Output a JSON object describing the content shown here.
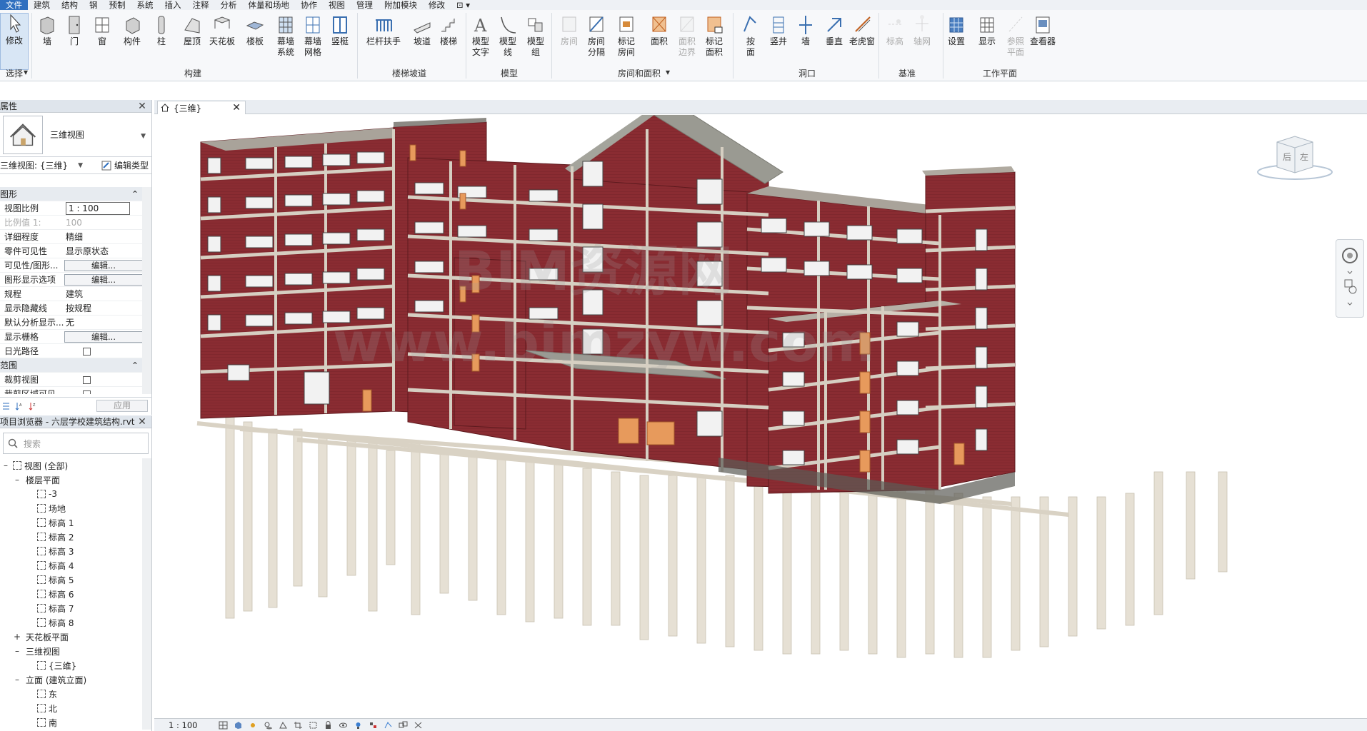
{
  "menu": {
    "items": [
      "文件",
      "建筑",
      "结构",
      "钢",
      "预制",
      "系统",
      "插入",
      "注释",
      "分析",
      "体量和场地",
      "协作",
      "视图",
      "管理",
      "附加模块",
      "修改"
    ],
    "active_index": 0
  },
  "ribbon": {
    "buttons": [
      {
        "label": "修改",
        "icon": "modify-arrow-icon"
      },
      {
        "label": "墙",
        "icon": "wall-icon"
      },
      {
        "label": "门",
        "icon": "door-icon"
      },
      {
        "label": "窗",
        "icon": "window-icon"
      },
      {
        "label": "构件",
        "icon": "component-icon"
      },
      {
        "label": "柱",
        "icon": "column-icon"
      },
      {
        "label": "屋顶",
        "icon": "roof-icon"
      },
      {
        "label": "天花板",
        "icon": "ceiling-icon"
      },
      {
        "label": "楼板",
        "icon": "floor-icon"
      },
      {
        "label": "幕墙\n系统",
        "icon": "curtain-system-icon"
      },
      {
        "label": "幕墙\n网格",
        "icon": "curtain-grid-icon"
      },
      {
        "label": "竖梃",
        "icon": "mullion-icon"
      },
      {
        "label": "栏杆扶手",
        "icon": "railing-icon"
      },
      {
        "label": "坡道",
        "icon": "ramp-icon"
      },
      {
        "label": "楼梯",
        "icon": "stair-icon"
      },
      {
        "label": "模型\n文字",
        "icon": "model-text-icon"
      },
      {
        "label": "模型\n线",
        "icon": "model-line-icon"
      },
      {
        "label": "模型\n组",
        "icon": "model-group-icon"
      },
      {
        "label": "房间",
        "icon": "room-icon",
        "disabled": true
      },
      {
        "label": "房间\n分隔",
        "icon": "room-separator-icon"
      },
      {
        "label": "标记\n房间",
        "icon": "tag-room-icon"
      },
      {
        "label": "面积",
        "icon": "area-icon"
      },
      {
        "label": "面积\n边界",
        "icon": "area-boundary-icon",
        "disabled": true
      },
      {
        "label": "标记\n面积",
        "icon": "tag-area-icon"
      },
      {
        "label": "按\n面",
        "icon": "by-face-icon"
      },
      {
        "label": "竖井",
        "icon": "shaft-icon"
      },
      {
        "label": "墙",
        "icon": "wall-opening-icon"
      },
      {
        "label": "垂直",
        "icon": "vertical-opening-icon"
      },
      {
        "label": "老虎窗",
        "icon": "dormer-icon"
      },
      {
        "label": "标高",
        "icon": "level-icon",
        "disabled": true
      },
      {
        "label": "轴网",
        "icon": "grid-icon",
        "disabled": true
      },
      {
        "label": "设置",
        "icon": "set-workplane-icon"
      },
      {
        "label": "显示",
        "icon": "show-workplane-icon"
      },
      {
        "label": "参照\n平面",
        "icon": "ref-plane-icon",
        "disabled": true
      },
      {
        "label": "查看器",
        "icon": "viewer-icon"
      }
    ],
    "groups": [
      "选择",
      "构建",
      "楼梯坡道",
      "模型",
      "房间和面积",
      "洞口",
      "基准",
      "工作平面"
    ]
  },
  "properties": {
    "title": "属性",
    "type_name": "三维视图",
    "instance_selector": "三维视图: {三维}",
    "edit_type": "编辑类型",
    "rows": [
      {
        "k": "图形",
        "cat": true
      },
      {
        "k": "视图比例",
        "v": "1 : 100",
        "kind": "input"
      },
      {
        "k": "比例值 1:",
        "v": "100",
        "dim": true
      },
      {
        "k": "详细程度",
        "v": "精细"
      },
      {
        "k": "零件可见性",
        "v": "显示原状态"
      },
      {
        "k": "可见性/图形...",
        "v": "编辑...",
        "kind": "button"
      },
      {
        "k": "图形显示选项",
        "v": "编辑...",
        "kind": "button"
      },
      {
        "k": "规程",
        "v": "建筑"
      },
      {
        "k": "显示隐藏线",
        "v": "按规程"
      },
      {
        "k": "默认分析显示...",
        "v": "无"
      },
      {
        "k": "显示栅格",
        "v": "编辑...",
        "kind": "button"
      },
      {
        "k": "日光路径",
        "kind": "check"
      },
      {
        "k": "范围",
        "cat": true
      },
      {
        "k": "裁剪视图",
        "kind": "check"
      },
      {
        "k": "裁剪区域可见",
        "kind": "check"
      }
    ],
    "apply": "应用"
  },
  "browser": {
    "title": "项目浏览器 - 六层学校建筑结构.rvt",
    "search_placeholder": "搜索",
    "nodes": [
      {
        "label": "视图 (全部)",
        "depth": 0,
        "toggle": "–",
        "icon": "views-root-icon"
      },
      {
        "label": "楼层平面",
        "depth": 1,
        "toggle": "–"
      },
      {
        "label": "-3",
        "depth": 2,
        "icon": "view-icon"
      },
      {
        "label": "场地",
        "depth": 2,
        "icon": "view-icon"
      },
      {
        "label": "标高 1",
        "depth": 2,
        "icon": "view-icon"
      },
      {
        "label": "标高 2",
        "depth": 2,
        "icon": "view-icon"
      },
      {
        "label": "标高 3",
        "depth": 2,
        "icon": "view-icon"
      },
      {
        "label": "标高 4",
        "depth": 2,
        "icon": "view-icon"
      },
      {
        "label": "标高 5",
        "depth": 2,
        "icon": "view-icon"
      },
      {
        "label": "标高 6",
        "depth": 2,
        "icon": "view-icon"
      },
      {
        "label": "标高 7",
        "depth": 2,
        "icon": "view-icon"
      },
      {
        "label": "标高 8",
        "depth": 2,
        "icon": "view-icon"
      },
      {
        "label": "天花板平面",
        "depth": 1,
        "toggle": "+"
      },
      {
        "label": "三维视图",
        "depth": 1,
        "toggle": "–"
      },
      {
        "label": "{三维}",
        "depth": 2,
        "icon": "view-icon"
      },
      {
        "label": "立面 (建筑立面)",
        "depth": 1,
        "toggle": "–"
      },
      {
        "label": "东",
        "depth": 2,
        "icon": "view-icon"
      },
      {
        "label": "北",
        "depth": 2,
        "icon": "view-icon"
      },
      {
        "label": "南",
        "depth": 2,
        "icon": "view-icon"
      }
    ]
  },
  "view": {
    "tab_label": "{三维}",
    "scale": "1 : 100",
    "viewcube": {
      "back": "后",
      "left": "左"
    },
    "watermark_1": "BIM资源网",
    "watermark_2": "www.bimzyw.com"
  },
  "colors": {
    "accent": "#2f6fbf",
    "brick": "#8a2c32",
    "concrete": "#e4ddd0",
    "roof": "#9a9a92"
  }
}
